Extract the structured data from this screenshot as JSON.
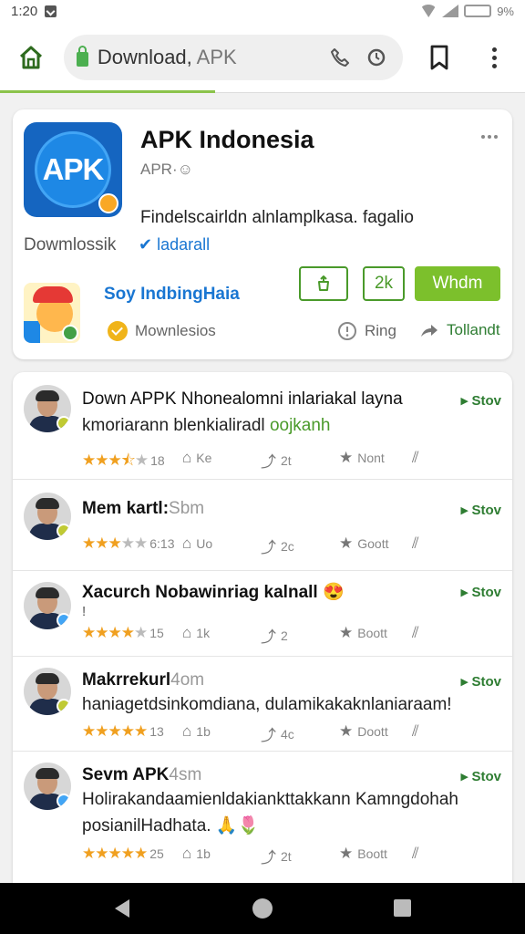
{
  "status_bar": {
    "time": "1:20",
    "battery": "9%"
  },
  "browser": {
    "url_main": "Download,",
    "url_dim": " APK",
    "load_progress": 0.41
  },
  "app": {
    "title": "APK Indonesia",
    "subtitle": "APR·☺",
    "logo_text": "APK",
    "description": "Findelscairldn alnlamplkasa. fagalio",
    "downloads_label": "Dowmlossik",
    "verified_label": "✔ ladarall",
    "developer": "Soy IndbingHaia",
    "btn_count": "2k",
    "btn_main": "Whdm",
    "meta_downloads": "Mownlesios",
    "meta_ring": "Ring",
    "meta_share": "Tollandt"
  },
  "reviews": [
    {
      "title": "Down APPK Nhonealomni inlariakal layna",
      "line2": "kmoriarann blenkialiradl ",
      "line2_green": "oojkanh",
      "follow": "▸ Stov",
      "rating": 3.5,
      "rating_count": "18",
      "reply": "Ke",
      "repost": "2t",
      "star_label": "Nont",
      "badge_color": "#c0ca33"
    },
    {
      "title": "Mem kartl:",
      "title_dim": "Sbm",
      "follow": "▸ Stov",
      "rating": 3,
      "rating_count": "6:13",
      "reply": "Uo",
      "repost": "2c",
      "star_label": "Goott",
      "badge_color": "#c0ca33"
    },
    {
      "title": "Xacurch Nobawinriag kalnall 😍",
      "line2": "!",
      "follow": "▸ Stov",
      "rating": 4,
      "rating_count": "15",
      "reply": "1k",
      "repost": "2",
      "star_label": "Boott",
      "badge_color": "#42a5f5"
    },
    {
      "title": "Makrrekurl",
      "title_dim": "4om",
      "line2": "haniagetdsinkomdiana, dulamikakaknlaniaraam!",
      "follow": "▸ Stov",
      "rating": 5,
      "rating_count": "13",
      "reply": "1b",
      "repost": "4c",
      "star_label": "Doott",
      "badge_color": "#c0ca33"
    },
    {
      "title": "Sevm APK",
      "title_dim": "4sm",
      "line2": "Holirakandaamienldakiankttakkann Kamngdohah",
      "line3": "posianilHadhata. 🙏🌷",
      "follow": "▸ Stov",
      "rating": 5,
      "rating_count": "25",
      "reply": "1b",
      "repost": "2t",
      "star_label": "Boott",
      "badge_color": "#42a5f5"
    }
  ],
  "colors": {
    "accent_green": "#7cc02c",
    "follow_green": "#2e7d32",
    "link_blue": "#1976d2",
    "star": "#f0a020"
  }
}
